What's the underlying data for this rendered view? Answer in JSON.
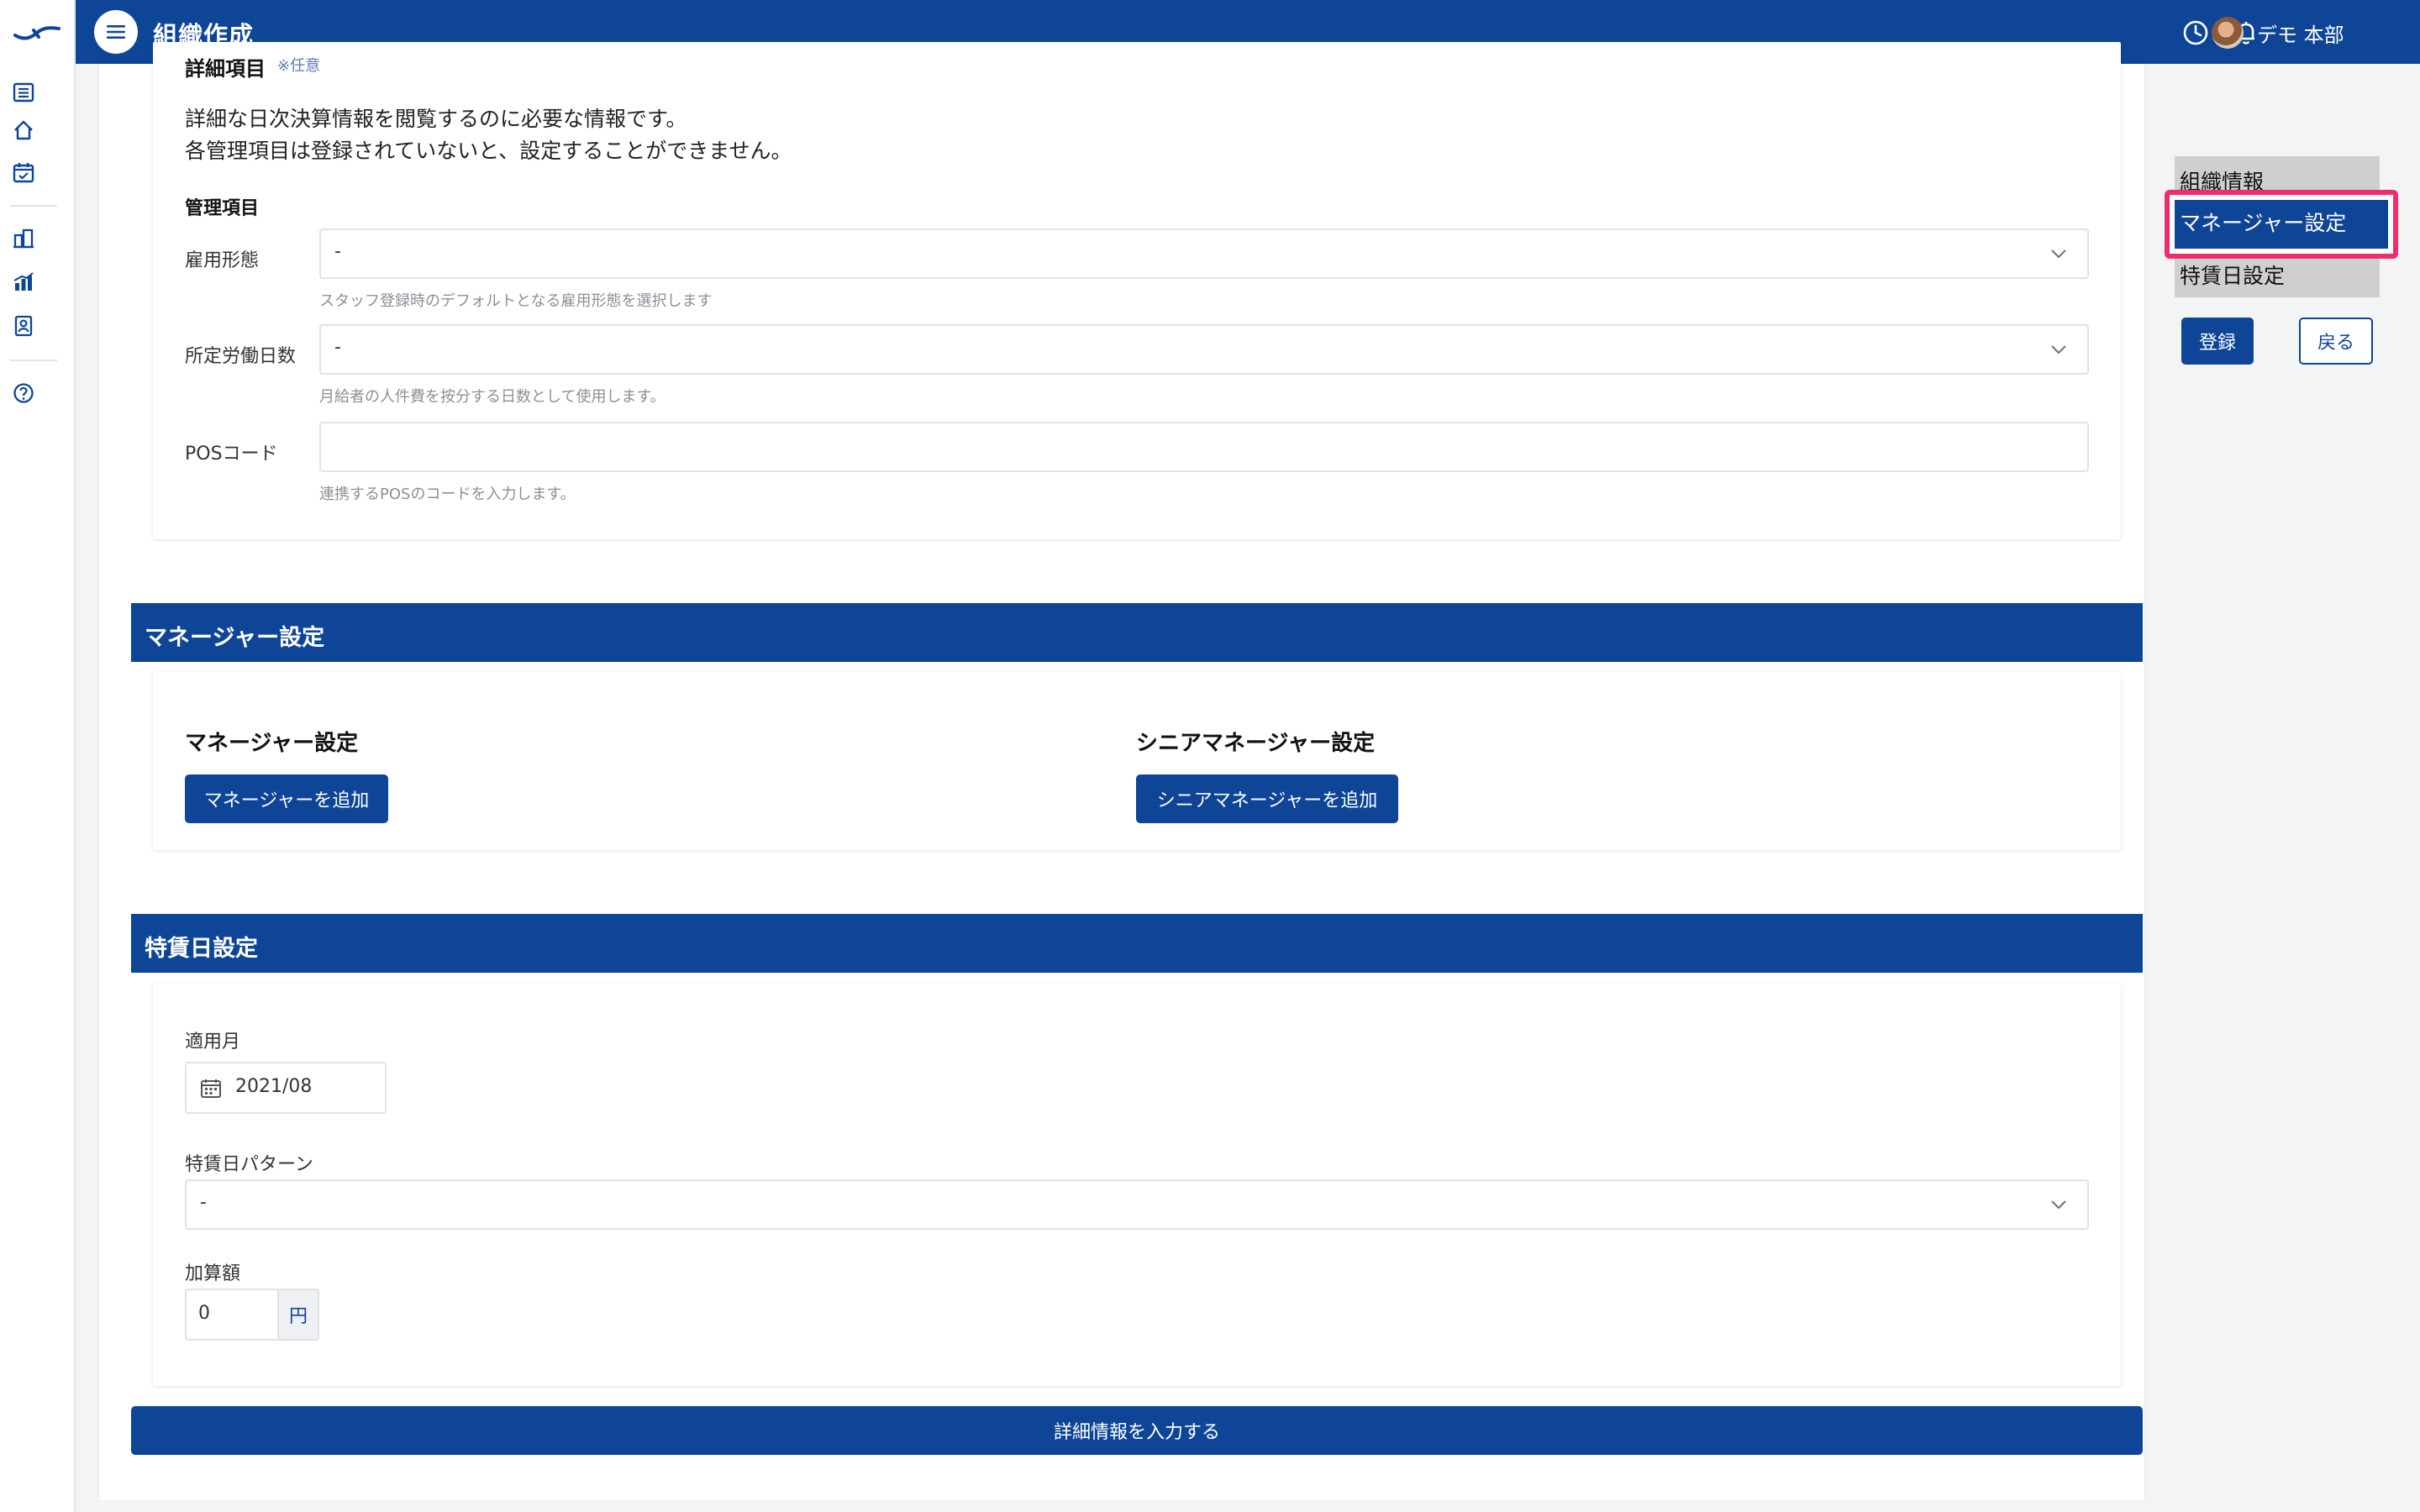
{
  "header": {
    "title": "組織作成",
    "user_name": "デモ 本部"
  },
  "detail_section": {
    "title_partial": "詳細項目",
    "optional_tag": "※任意",
    "desc_line1": "詳細な日次決算情報を閲覧するのに必要な情報です。",
    "desc_line2": "各管理項目は登録されていないと、設定することができません。",
    "subheading": "管理項目",
    "employment_type": {
      "label": "雇用形態",
      "value": "-",
      "help": "スタッフ登録時のデフォルトとなる雇用形態を選択します"
    },
    "work_days": {
      "label": "所定労働日数",
      "value": "-",
      "help": "月給者の人件費を按分する日数として使用します。"
    },
    "pos_code": {
      "label": "POSコード",
      "value": "",
      "help": "連携するPOSのコードを入力します。"
    }
  },
  "manager_section": {
    "header": "マネージャー設定",
    "manager_title": "マネージャー設定",
    "add_manager": "マネージャーを追加",
    "senior_title": "シニアマネージャー設定",
    "add_senior": "シニアマネージャーを追加"
  },
  "special_wage_section": {
    "header": "特賃日設定",
    "month_label": "適用月",
    "month_value": "2021/08",
    "pattern_label": "特賃日パターン",
    "pattern_value": "-",
    "amount_label": "加算額",
    "amount_value": "0",
    "amount_unit": "円"
  },
  "submit_detail_label": "詳細情報を入力する",
  "right_nav": {
    "items": [
      "組織情報",
      "マネージャー設定",
      "特賃日設定"
    ],
    "active_index": 1,
    "register": "登録",
    "back": "戻る"
  },
  "colors": {
    "primary": "#0e4597",
    "highlight": "#ee2d6c",
    "nav_inactive": "#cfcfcf"
  },
  "icons": [
    "logo-icon",
    "list-icon",
    "home-icon",
    "calendar-check-icon",
    "building-chart-icon",
    "bar-chart-icon",
    "id-badge-icon",
    "help-icon",
    "menu-icon",
    "clock-icon",
    "bell-icon",
    "calendar-icon",
    "chevron-down-icon"
  ]
}
